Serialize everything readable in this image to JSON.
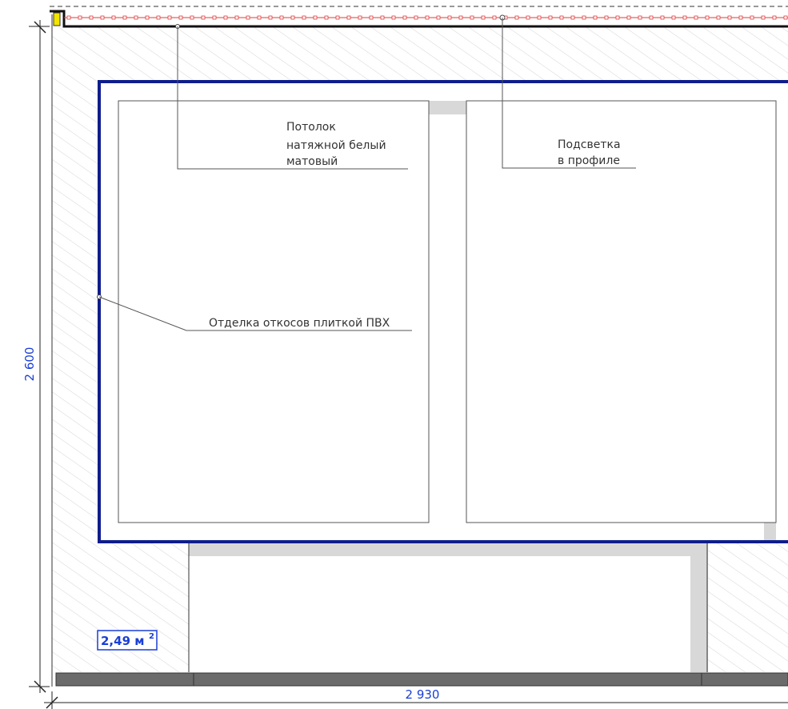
{
  "labels": {
    "ceiling": [
      "Потолок",
      "натяжной белый",
      "матовый"
    ],
    "lighting": [
      "Подсветка",
      "в профиле"
    ],
    "reveal_finish": "Отделка откосов плиткой ПВХ"
  },
  "dimensions": {
    "height": "2 600",
    "width": "2 930"
  },
  "area": {
    "value": "2,49 м",
    "unit_superscript": "2"
  },
  "colors": {
    "window_frame": "#0f1d8c",
    "dimension_text": "#1a3fd6",
    "led_strip": "#e23b3b",
    "reveal_shadow": "#d8d8d8",
    "floor_strip": "#6b6b6b",
    "hatch": "#d4d4d4",
    "fixture_marker": "#f2e600"
  }
}
